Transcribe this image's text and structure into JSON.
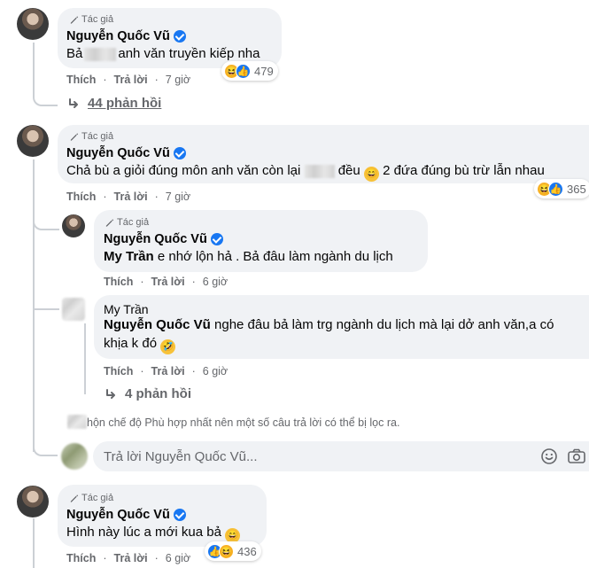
{
  "comments": [
    {
      "author_tag": "Tác giả",
      "name": "Nguyễn Quốc Vũ",
      "text_before": "Bả",
      "text_after": "anh văn truyền kiếp nha",
      "like_label": "Thích",
      "reply_label": "Trả lời",
      "time": "7 giờ",
      "reaction_count": "479",
      "replies_label": "44 phản hồi"
    },
    {
      "author_tag": "Tác giả",
      "name": "Nguyễn Quốc Vũ",
      "text_before": "Chả bù a giỏi đúng môn anh văn còn lại",
      "text_after": "đều",
      "text_end": "2 đứa đúng bù trừ lẫn nhau",
      "like_label": "Thích",
      "reply_label": "Trả lời",
      "time": "7 giờ",
      "reaction_count": "365",
      "replies": [
        {
          "author_tag": "Tác giả",
          "name": "Nguyễn Quốc Vũ",
          "mention": "My Trần",
          "text": "e nhớ lộn hả . Bả đâu làm ngành du lịch",
          "like_label": "Thích",
          "reply_label": "Trả lời",
          "time": "6 giờ"
        },
        {
          "name": "My Trần",
          "mention": "Nguyễn Quốc Vũ",
          "text_line1": "nghe đâu bả làm trg ngành du lịch mà lại dở anh văn,a có",
          "text_line2": "khịa k đó",
          "like_label": "Thích",
          "reply_label": "Trả lời",
          "time": "6 giờ",
          "replies_label": "4 phản hồi"
        }
      ],
      "filter_notice": "hộn chế độ Phù hợp nhất nên một số câu trả lời có thể bị lọc ra.",
      "reply_placeholder": "Trả lời Nguyễn Quốc Vũ..."
    },
    {
      "author_tag": "Tác giả",
      "name": "Nguyễn Quốc Vũ",
      "text": "Hình này lúc a mới kua bả",
      "like_label": "Thích",
      "reply_label": "Trả lời",
      "time": "6 giờ",
      "reaction_count": "436"
    }
  ],
  "icons": {
    "author_badge": "pencil-icon",
    "verified": "verified-badge-icon",
    "reply_arrow": "reply-arrow-icon",
    "emoji_button": "emoji-icon",
    "camera_button": "camera-icon"
  },
  "colors": {
    "bubble": "#f0f2f5",
    "secondary_text": "#65676b",
    "verified_blue": "#1877f2",
    "haha_yellow": "#f7b125"
  }
}
